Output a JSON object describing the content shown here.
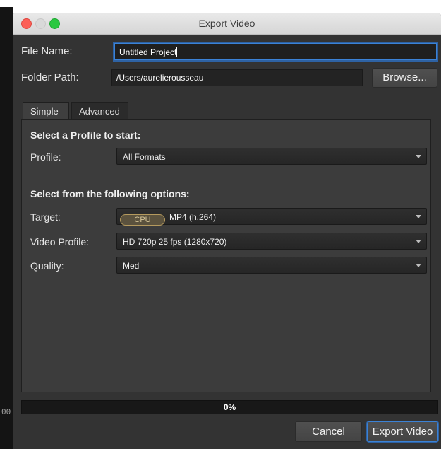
{
  "background": {
    "edge_text": "00"
  },
  "window": {
    "title": "Export Video",
    "file_name_label": "File Name:",
    "file_name_value": "Untitled Project",
    "folder_path_label": "Folder Path:",
    "folder_path_value": "/Users/aurelierousseau",
    "browse_label": "Browse..."
  },
  "tabs": [
    {
      "label": "Simple",
      "selected": true
    },
    {
      "label": "Advanced",
      "selected": false
    }
  ],
  "simple": {
    "profile_heading": "Select a Profile to start:",
    "profile_label": "Profile:",
    "profile_value": "All Formats",
    "options_heading": "Select from the following options:",
    "target_label": "Target:",
    "target_badge": "CPU",
    "target_value": "MP4 (h.264)",
    "video_profile_label": "Video Profile:",
    "video_profile_value": "HD 720p 25 fps (1280x720)",
    "quality_label": "Quality:",
    "quality_value": "Med"
  },
  "progress": {
    "value": 0,
    "text": "0%"
  },
  "buttons": {
    "cancel": "Cancel",
    "export": "Export Video"
  },
  "colors": {
    "accent": "#3b82d6",
    "window_bg": "#333333",
    "panel_bg": "#3c3c3c"
  }
}
